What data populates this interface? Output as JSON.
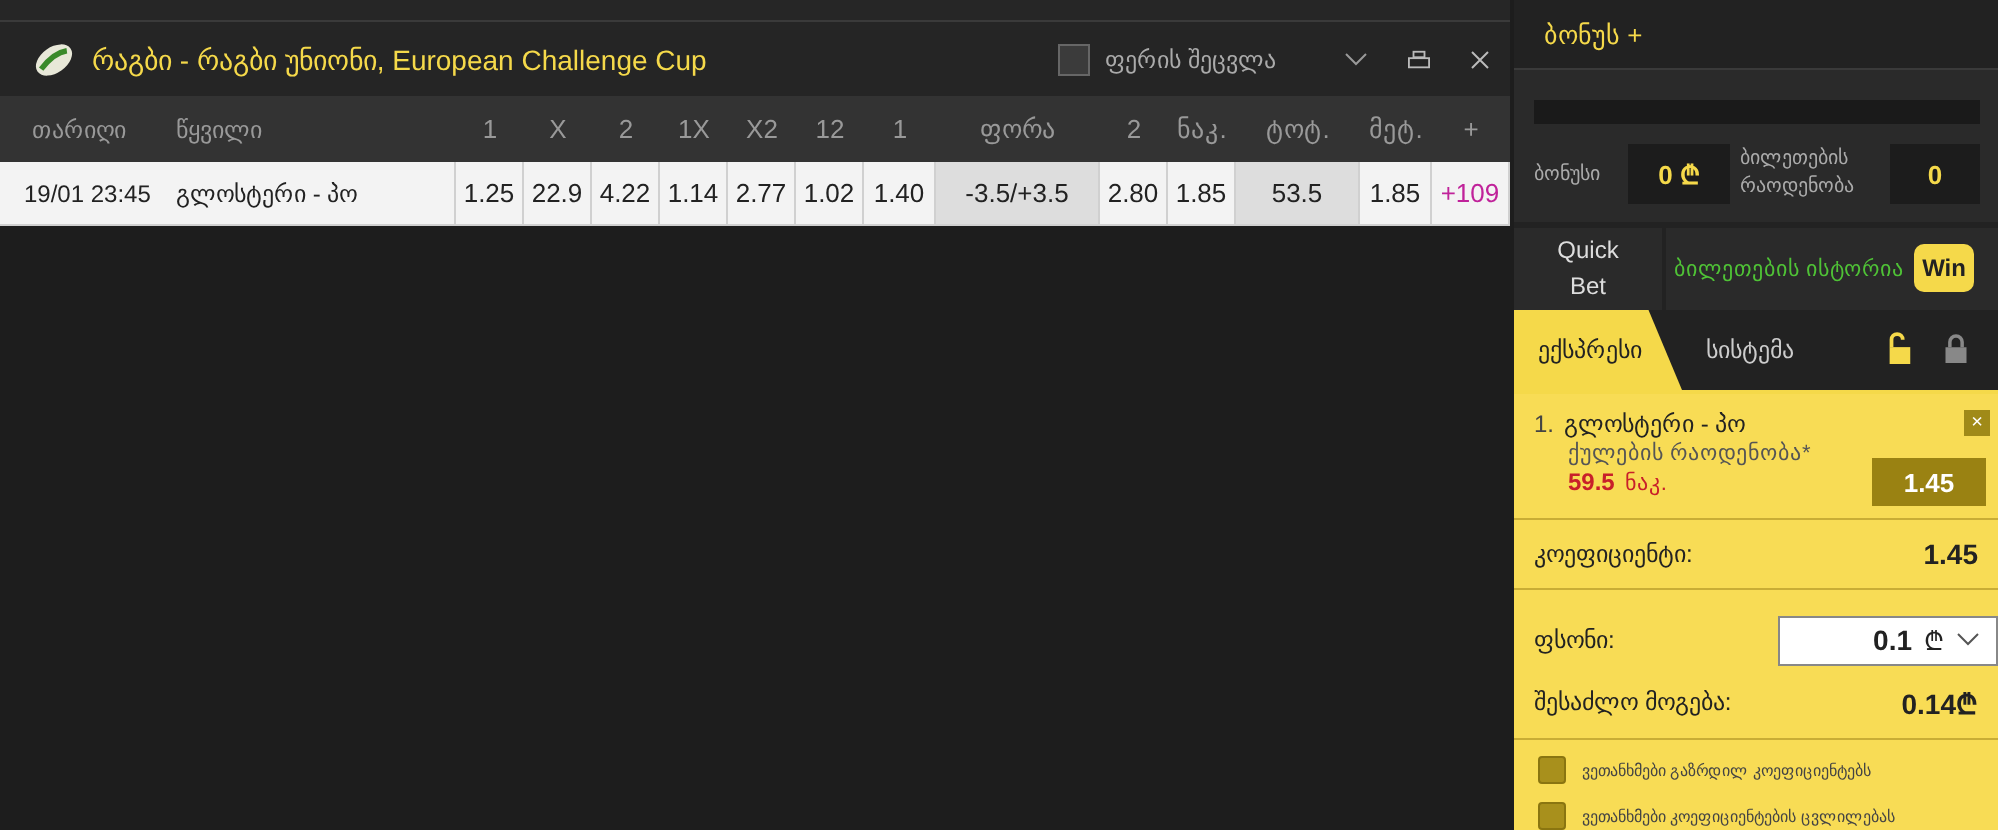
{
  "event_header": {
    "title": "რაგბი - რაგბი უნიონი, European Challenge Cup",
    "color_toggle": {
      "label": "ფერის შეცვლა",
      "checked": false
    }
  },
  "table": {
    "columns": [
      {
        "label": "თარიღი",
        "kind": "text"
      },
      {
        "label": "წყვილი",
        "kind": "text"
      },
      {
        "label": "1",
        "kind": "odd"
      },
      {
        "label": "X",
        "kind": "odd"
      },
      {
        "label": "2",
        "kind": "odd"
      },
      {
        "label": "1X",
        "kind": "odd"
      },
      {
        "label": "X2",
        "kind": "odd"
      },
      {
        "label": "12",
        "kind": "odd"
      },
      {
        "label": "1",
        "kind": "odd"
      },
      {
        "label": "ფორა",
        "kind": "line"
      },
      {
        "label": "2",
        "kind": "odd"
      },
      {
        "label": "ნაკ.",
        "kind": "odd"
      },
      {
        "label": "ტოტ.",
        "kind": "line"
      },
      {
        "label": "მეტ.",
        "kind": "odd"
      },
      {
        "label": "+",
        "kind": "more"
      }
    ],
    "rows": [
      {
        "cells": [
          "19/01 23:45",
          "გლოსტერი - პო",
          "1.25",
          "22.9",
          "4.22",
          "1.14",
          "2.77",
          "1.02",
          "1.40",
          "-3.5/+3.5",
          "2.80",
          "1.85",
          "53.5",
          "1.85",
          "+109"
        ]
      }
    ]
  },
  "bonus_panel": {
    "title": "ბონუს +",
    "bonus_label": "ბონუსი",
    "bonus_value": "0 ₾",
    "tickets_label": "ბილეთების რაოდენობა",
    "tickets_value": "0"
  },
  "quick_bet": "Quick Bet",
  "history": {
    "label": "ბილეთების ისტორია",
    "badge": "Win"
  },
  "slip_tabs": [
    {
      "label": "ექსპრესი",
      "selected": true
    },
    {
      "label": "სისტემა",
      "selected": false
    }
  ],
  "bet": {
    "number": "1.",
    "match": "გლოსტერი - პო",
    "market": "ქულების რაოდენობა*",
    "line": "59.5",
    "line_suffix": "ნაკ.",
    "odd": "1.45",
    "remove": "×"
  },
  "coefficient": {
    "label": "კოეფიციენტი:",
    "value": "1.45"
  },
  "stake": {
    "label": "ფსონი:",
    "value": "0.1",
    "currency": "₾"
  },
  "possible_win": {
    "label": "შესაძლო მოგება:",
    "value": "0.14₾"
  },
  "agreements": [
    {
      "label": "ვეთანხმები გაზრდილ კოეფიციენტებს",
      "checked": false
    },
    {
      "label": "ვეთანხმები კოეფიციენტების ცვლილებას",
      "checked": false
    }
  ]
}
